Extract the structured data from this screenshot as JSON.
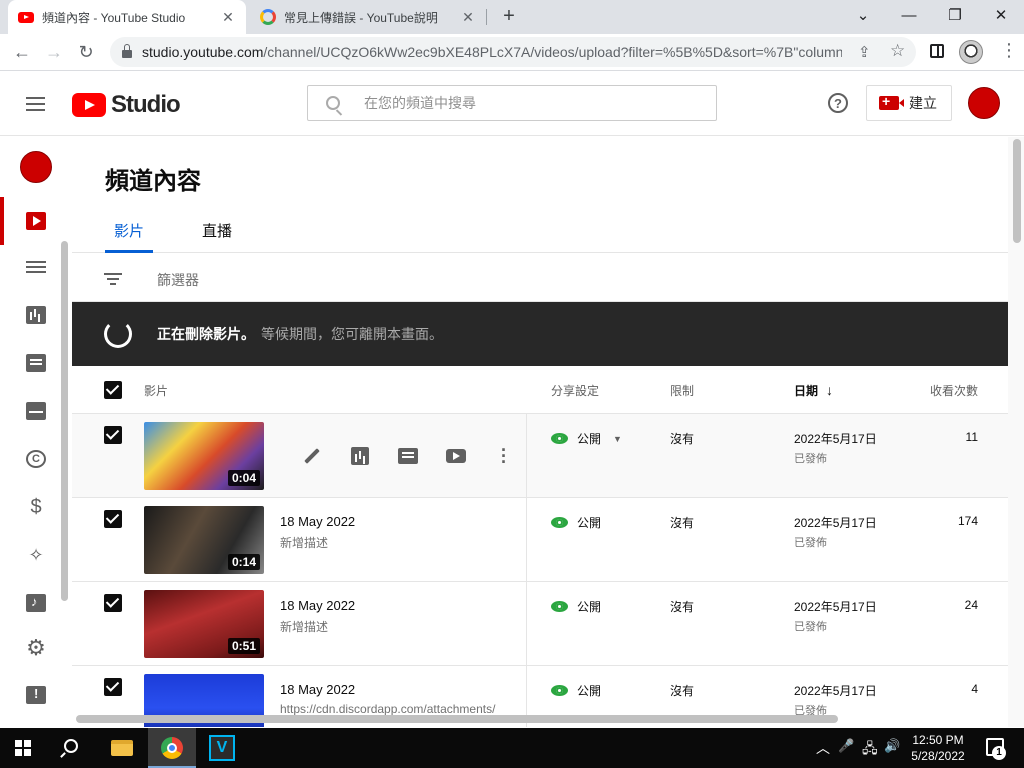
{
  "browser": {
    "tabs": [
      {
        "title": "頻道內容 - YouTube Studio",
        "active": true,
        "icon": "youtube-favicon"
      },
      {
        "title": "常見上傳錯誤 - YouTube說明",
        "active": false,
        "icon": "google-favicon"
      }
    ],
    "close_glyph": "✕",
    "new_tab_glyph": "+",
    "window_controls": {
      "chevron": "⌄",
      "minimize": "—",
      "restore": "❐",
      "close": "✕"
    },
    "url_host": "studio.youtube.com",
    "url_rest": "/channel/UCQzO6kWw2ec9bXE48PLcX7A/videos/upload?filter=%5B%5D&sort=%7B\"column...",
    "nav": {
      "back": "←",
      "forward": "→",
      "reload": "↻"
    },
    "share_glyph": "⇪",
    "star_glyph": "☆",
    "menu_glyph": "⋮"
  },
  "studio": {
    "logo_text": "Studio",
    "search_placeholder": "在您的頻道中搜尋",
    "help_glyph": "?",
    "create_label": "建立"
  },
  "sidebar": {
    "items": [
      "channel-content",
      "playlists",
      "analytics",
      "comments",
      "subtitles",
      "copyright",
      "earn",
      "customization",
      "audio-library",
      "settings",
      "send-feedback"
    ],
    "copyright_glyph": "C",
    "dollar_glyph": "$",
    "wand_glyph": "✧",
    "gear_glyph": "⚙"
  },
  "main": {
    "title": "頻道內容",
    "tabs": [
      {
        "label": "影片",
        "active": true
      },
      {
        "label": "直播",
        "active": false
      }
    ],
    "filter_label": "篩選器",
    "banner": {
      "strong": "正在刪除影片。",
      "sub": "等候期間，您可離開本畫面。"
    },
    "columns": {
      "video": "影片",
      "visibility": "分享設定",
      "restrictions": "限制",
      "date": "日期",
      "date_arrow": "↓",
      "views": "收看次數"
    },
    "videos": [
      {
        "title": "",
        "description": "",
        "duration": "0:04",
        "visibility": "公開",
        "restrictions": "沒有",
        "date": "2022年5月17日",
        "status": "已發佈",
        "views": "11",
        "hover": true
      },
      {
        "title": "18 May 2022",
        "description": "新增描述",
        "duration": "0:14",
        "visibility": "公開",
        "restrictions": "沒有",
        "date": "2022年5月17日",
        "status": "已發佈",
        "views": "174",
        "hover": false
      },
      {
        "title": "18 May 2022",
        "description": "新增描述",
        "duration": "0:51",
        "visibility": "公開",
        "restrictions": "沒有",
        "date": "2022年5月17日",
        "status": "已發佈",
        "views": "24",
        "hover": false
      },
      {
        "title": "18 May 2022",
        "description": "https://cdn.discordapp.com/attachments/",
        "duration": "",
        "visibility": "公開",
        "restrictions": "沒有",
        "date": "2022年5月17日",
        "status": "已發佈",
        "views": "4",
        "hover": false
      }
    ],
    "row_actions": [
      "details",
      "analytics",
      "comments",
      "view-on-youtube",
      "options"
    ],
    "caret_glyph": "▼"
  },
  "taskbar": {
    "apps": [
      "file-explorer",
      "chrome",
      "v-app"
    ],
    "v_label": "V",
    "tray": {
      "chevron": "︿",
      "mic": "🎤",
      "network": "🖧",
      "volume": "🔊"
    },
    "time": "12:50 PM",
    "date": "5/28/2022",
    "notifications": "1"
  }
}
